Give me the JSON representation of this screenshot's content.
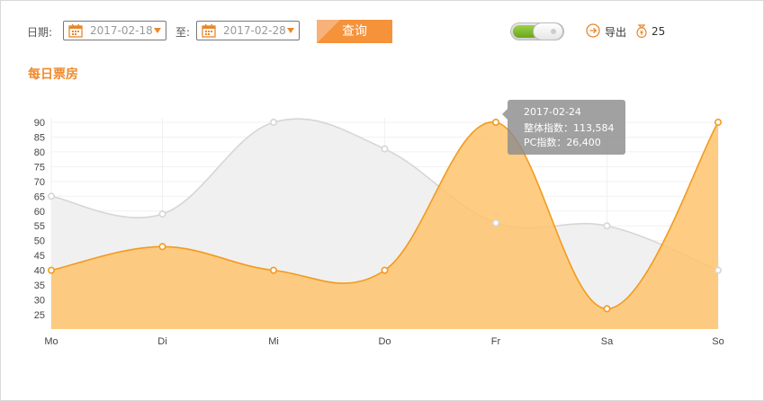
{
  "filters": {
    "date_label": "日期:",
    "start_date": "2017-02-18",
    "to_label": "至:",
    "end_date": "2017-02-28",
    "query_button": "查询"
  },
  "actions": {
    "export_label": "导出",
    "coin_count": "25",
    "toggle_on": true
  },
  "section_title": "每日票房",
  "tooltip": {
    "date": "2017-02-24",
    "line1": "整体指数：113,584",
    "line2": "PC指数：26,400"
  },
  "colors": {
    "accent": "#f5923a",
    "orange_line": "#f39a1e",
    "orange_fill": "#fec46d",
    "gray_line": "#d6d6d6",
    "gray_fill": "#eeeeee"
  },
  "chart_data": {
    "type": "area",
    "categories": [
      "Mo",
      "Di",
      "Mi",
      "Do",
      "Fr",
      "Sa",
      "So"
    ],
    "series": [
      {
        "values": [
          65,
          59,
          90,
          81,
          56,
          55,
          40
        ]
      },
      {
        "values": [
          40,
          48,
          40,
          40,
          90,
          27,
          90
        ]
      }
    ],
    "y_ticks": [
      90,
      85,
      80,
      75,
      70,
      65,
      60,
      55,
      50,
      45,
      40,
      35,
      30,
      25
    ],
    "ylim": [
      20,
      90
    ],
    "grid": true,
    "title": "",
    "xlabel": "",
    "ylabel": ""
  }
}
